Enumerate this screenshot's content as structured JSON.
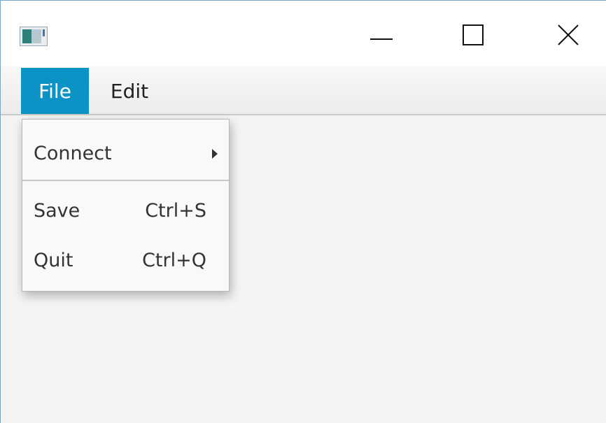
{
  "window": {
    "app_icon": "app-window-icon",
    "controls": {
      "minimize_icon": "minimize-icon",
      "maximize_icon": "maximize-icon",
      "close_icon": "close-icon"
    }
  },
  "menubar": {
    "items": [
      {
        "label": "File",
        "state": "open"
      },
      {
        "label": "Edit"
      }
    ]
  },
  "file_menu": {
    "items": [
      {
        "label": "Connect",
        "submenu": true
      },
      {
        "label": "Save",
        "accelerator": "Ctrl+S"
      },
      {
        "label": "Quit",
        "accelerator": "Ctrl+Q"
      }
    ]
  },
  "colors": {
    "menu_active_bg": "#0b93c6",
    "window_bg": "#f4f4f4"
  }
}
